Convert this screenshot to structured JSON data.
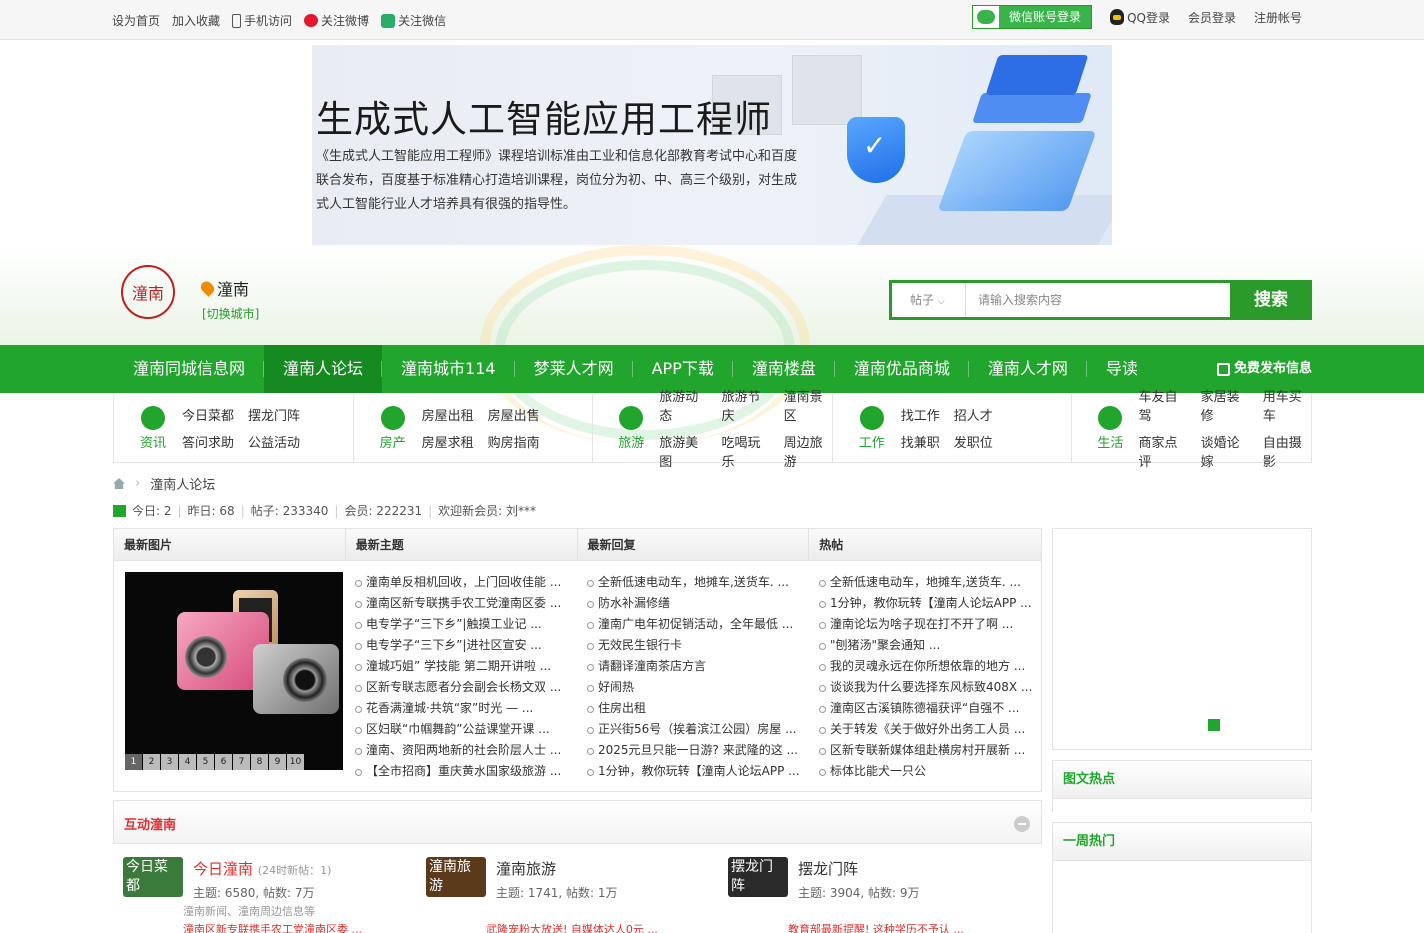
{
  "topbar": {
    "left": [
      "设为首页",
      "加入收藏",
      "手机访问",
      "关注微博",
      "关注微信"
    ],
    "wechat_login": "微信账号登录",
    "qq_login": "QQ登录",
    "member_login": "会员登录",
    "register": "注册帐号"
  },
  "banner": {
    "title": "生成式人工智能应用工程师",
    "desc": "《生成式人工智能应用工程师》课程培训标准由工业和信息化部教育考试中心和百度联合发布，百度基于标准精心打造培训课程，岗位分为初、中、高三个级别，对生成式人工智能行业人才培养具有很强的指导性。"
  },
  "header": {
    "logo_text": "潼南",
    "city": "潼南",
    "switch_city": "[切换城市]",
    "search_type": "帖子",
    "search_placeholder": "请输入搜索内容",
    "search_button": "搜索"
  },
  "nav": {
    "items": [
      "潼南同城信息网",
      "潼南人论坛",
      "潼南城市114",
      "梦莱人才网",
      "APP下载",
      "潼南楼盘",
      "潼南优品商城",
      "潼南人才网",
      "导读"
    ],
    "active": "潼南人论坛",
    "publish": "免费发布信息"
  },
  "categories": [
    {
      "name": "资讯",
      "links": [
        "今日菜都",
        "摆龙门阵",
        "答问求助",
        "公益活动"
      ]
    },
    {
      "name": "房产",
      "links": [
        "房屋出租",
        "房屋出售",
        "房屋求租",
        "购房指南"
      ]
    },
    {
      "name": "旅游",
      "links": [
        "旅游动态",
        "旅游节庆",
        "潼南景区",
        "旅游美图",
        "吃喝玩乐",
        "周边旅游"
      ]
    },
    {
      "name": "工作",
      "links": [
        "找工作",
        "招人才",
        "找兼职",
        "发职位"
      ]
    },
    {
      "name": "生活",
      "links": [
        "车友自驾",
        "家居装修",
        "用车买车",
        "商家点评",
        "谈婚论嫁",
        "自由摄影"
      ]
    }
  ],
  "breadcrumb": {
    "current": "潼南人论坛"
  },
  "stats": {
    "today": "今日: 2",
    "yesterday": "昨日: 68",
    "posts": "帖子: 233340",
    "members": "会员: 222231",
    "welcome": "欢迎新会员: 刘***"
  },
  "main": {
    "headers": [
      "最新图片",
      "最新主题",
      "最新回复",
      "热帖"
    ],
    "pager": [
      "1",
      "2",
      "3",
      "4",
      "5",
      "6",
      "7",
      "8",
      "9",
      "10"
    ],
    "new_topics": [
      "潼南单反相机回收，上门回收佳能 ...",
      "潼南区新专联携手农工党潼南区委 ...",
      "电专学子“三下乡”|触摸工业记 ...",
      "电专学子“三下乡”|进社区宣安 ...",
      "潼城巧姐” 学技能 第二期开讲啦 ...",
      "区新专联志愿者分会副会长杨文双 ...",
      "花香满潼城·共筑“家”时光 — ...",
      "区妇联“巾帼舞韵”公益课堂开课 ...",
      "潼南、资阳两地新的社会阶层人士 ...",
      "【全市招商】重庆黄水国家级旅游 ..."
    ],
    "new_replies": [
      "全新低速电动车，地摊车,送货车. ...",
      "防水补漏修缮",
      "潼南广电年初促销活动，全年最低 ...",
      "无效民生银行卡",
      "请翻译潼南茶店方言",
      "好闹热",
      "住房出租",
      "正兴街56号（挨着滨江公园）房屋 ...",
      "2025元旦只能一日游? 来武隆的这 ...",
      "1分钟，教你玩转【潼南人论坛APP ..."
    ],
    "hot": [
      "全新低速电动车，地摊车,送货车. ...",
      "1分钟，教你玩转【潼南人论坛APP ...",
      "潼南论坛为啥子现在打不开了啊 ...",
      "\"刨猪汤\"聚会通知 ...",
      "我的灵魂永远在你所想依靠的地方 ...",
      "谈谈我为什么要选择东风标致408X ...",
      "潼南区古溪镇陈德福获评“自强不 ...",
      "关于转发《关于做好外出务工人员 ...",
      "区新专联新媒体组赴横房村开展新 ...",
      "标体比能犬一只公"
    ]
  },
  "sidebar": {
    "pic_hot": "图文热点",
    "week_hot": "一周热门"
  },
  "interactive": {
    "title": "互动潼南",
    "forums": [
      {
        "thumb": "今日菜都",
        "name": "今日潼南",
        "new": "(24时新帖：1)",
        "meta": "主题: 6580, 帖数: 7万",
        "desc": "潼南新闻、潼南周边信息等",
        "last": "潼南区新专联携手农工党潼南区委 ...",
        "color": "#3a7a3a"
      },
      {
        "thumb": "潼南旅游",
        "name": "潼南旅游",
        "new": "",
        "meta": "主题: 1741, 帖数: 1万",
        "desc": "",
        "last": "武隆宠粉大放送! 自媒体达人0元 ...",
        "color": "#5a3a1a"
      },
      {
        "thumb": "摆龙门阵",
        "name": "摆龙门阵",
        "new": "",
        "meta": "主题: 3904, 帖数: 9万",
        "desc": "",
        "last": "教育部最新提醒! 这种学历不予认 ...",
        "color": "#2a2a2a"
      }
    ]
  }
}
